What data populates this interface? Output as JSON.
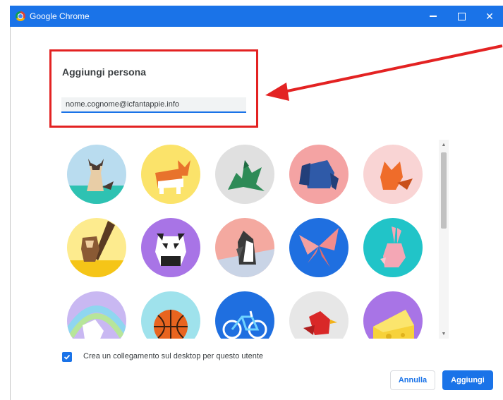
{
  "window": {
    "title": "Google Chrome",
    "controls": {
      "minimize": "minimize",
      "maximize": "maximize",
      "close": "✕"
    }
  },
  "dialog": {
    "heading": "Aggiungi persona",
    "name_input_value": "nome.cognome@icfantappie.info",
    "avatars": [
      {
        "name": "cat",
        "bg": "#b9dcef"
      },
      {
        "name": "corgi",
        "bg": "#fbe36a"
      },
      {
        "name": "dragon",
        "bg": "#e0e0e0"
      },
      {
        "name": "elephant",
        "bg": "#f4a3a3"
      },
      {
        "name": "fox",
        "bg": "#f9d4d4"
      },
      {
        "name": "monkey",
        "bg": "#fdeb8e"
      },
      {
        "name": "panda",
        "bg": "#a874e6"
      },
      {
        "name": "penguin",
        "bg": "#f4a9a0"
      },
      {
        "name": "butterfly",
        "bg": "#1f6fe0"
      },
      {
        "name": "rabbit",
        "bg": "#21c4c8"
      },
      {
        "name": "unicorn",
        "bg": "#c9b8f2"
      },
      {
        "name": "basketball",
        "bg": "#9fe2ec"
      },
      {
        "name": "bicycle",
        "bg": "#1f6fe0"
      },
      {
        "name": "bird",
        "bg": "#e7e7e7"
      },
      {
        "name": "cheese",
        "bg": "#a874e6"
      }
    ],
    "checkbox": {
      "checked": true,
      "label": "Crea un collegamento sul desktop per questo utente"
    },
    "buttons": {
      "cancel": "Annulla",
      "add": "Aggiungi"
    }
  },
  "annotation": {
    "color": "#e32222"
  },
  "colors": {
    "accent": "#1a73e8"
  }
}
